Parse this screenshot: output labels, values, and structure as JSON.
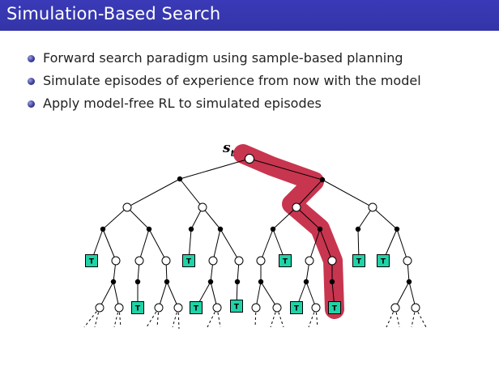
{
  "slide": {
    "title": "Simulation-Based Search",
    "bullets": [
      "Forward search paradigm using sample-based planning",
      "Simulate episodes of experience from now with the model",
      "Apply model-free RL to simulated episodes"
    ]
  },
  "diagram": {
    "root_label": "s",
    "root_subscript": "t",
    "terminal_label": "T",
    "colors": {
      "title_bar": "#3535b0",
      "terminal_fill": "#1fd3a8",
      "highlight": "#c8354f",
      "edge": "#000000"
    }
  }
}
